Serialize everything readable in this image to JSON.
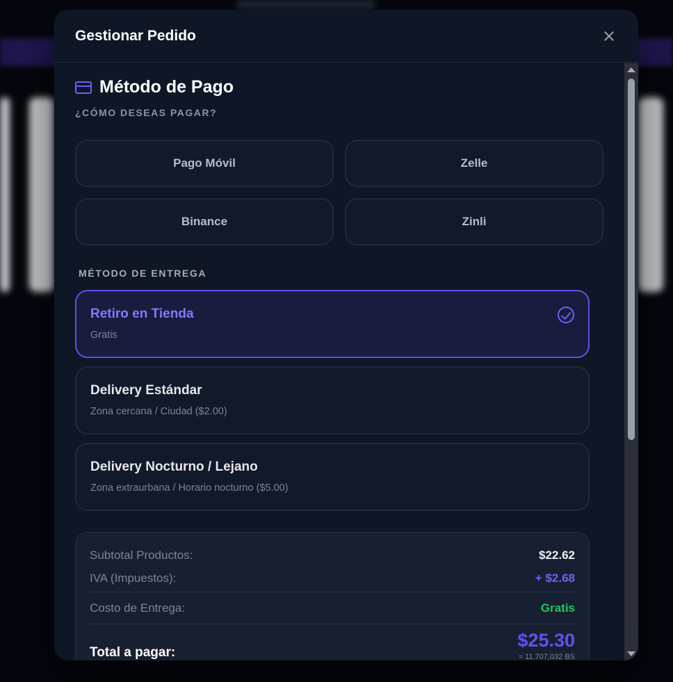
{
  "modal": {
    "title": "Gestionar Pedido"
  },
  "payment": {
    "heading": "Método de Pago",
    "question": "¿CÓMO DESEAS PAGAR?",
    "methods": [
      "Pago Móvil",
      "Zelle",
      "Binance",
      "Zinli"
    ]
  },
  "delivery": {
    "label": "MÉTODO DE ENTREGA",
    "options": [
      {
        "title": "Retiro en Tienda",
        "desc": "Gratis",
        "selected": true
      },
      {
        "title": "Delivery Estándar",
        "desc": "Zona cercana / Ciudad ($2.00)",
        "selected": false
      },
      {
        "title": "Delivery Nocturno / Lejano",
        "desc": "Zona extraurbana / Horario nocturno ($5.00)",
        "selected": false
      }
    ]
  },
  "summary": {
    "subtotal_label": "Subtotal Productos:",
    "subtotal_value": "$22.62",
    "iva_label": "IVA (Impuestos):",
    "iva_value": "+ $2.68",
    "delivery_label": "Costo de Entrega:",
    "delivery_value": "Gratis",
    "total_label": "Total a pagar:",
    "total_value": "$25.30",
    "total_bs": "≈ 11.707,032 BS"
  },
  "colors": {
    "accent": "#6366f1",
    "success": "#22c55e",
    "background": "#0f1727"
  }
}
